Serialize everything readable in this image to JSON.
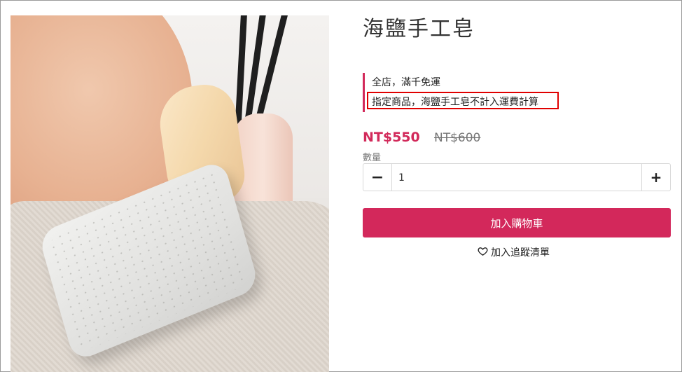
{
  "product": {
    "title": "海鹽手工皂",
    "promotions": [
      "全店，滿千免運",
      "指定商品，海鹽手工皂不計入運費計算"
    ],
    "price": "NT$550",
    "original_price": "NT$600"
  },
  "quantity": {
    "label": "數量",
    "value": "1",
    "minus": "−",
    "plus": "+"
  },
  "actions": {
    "add_to_cart": "加入購物車",
    "wishlist": "加入追蹤清單",
    "wishlist_icon": "heart-outline-icon"
  },
  "colors": {
    "accent": "#d3285b",
    "highlight_border": "#e00000"
  }
}
